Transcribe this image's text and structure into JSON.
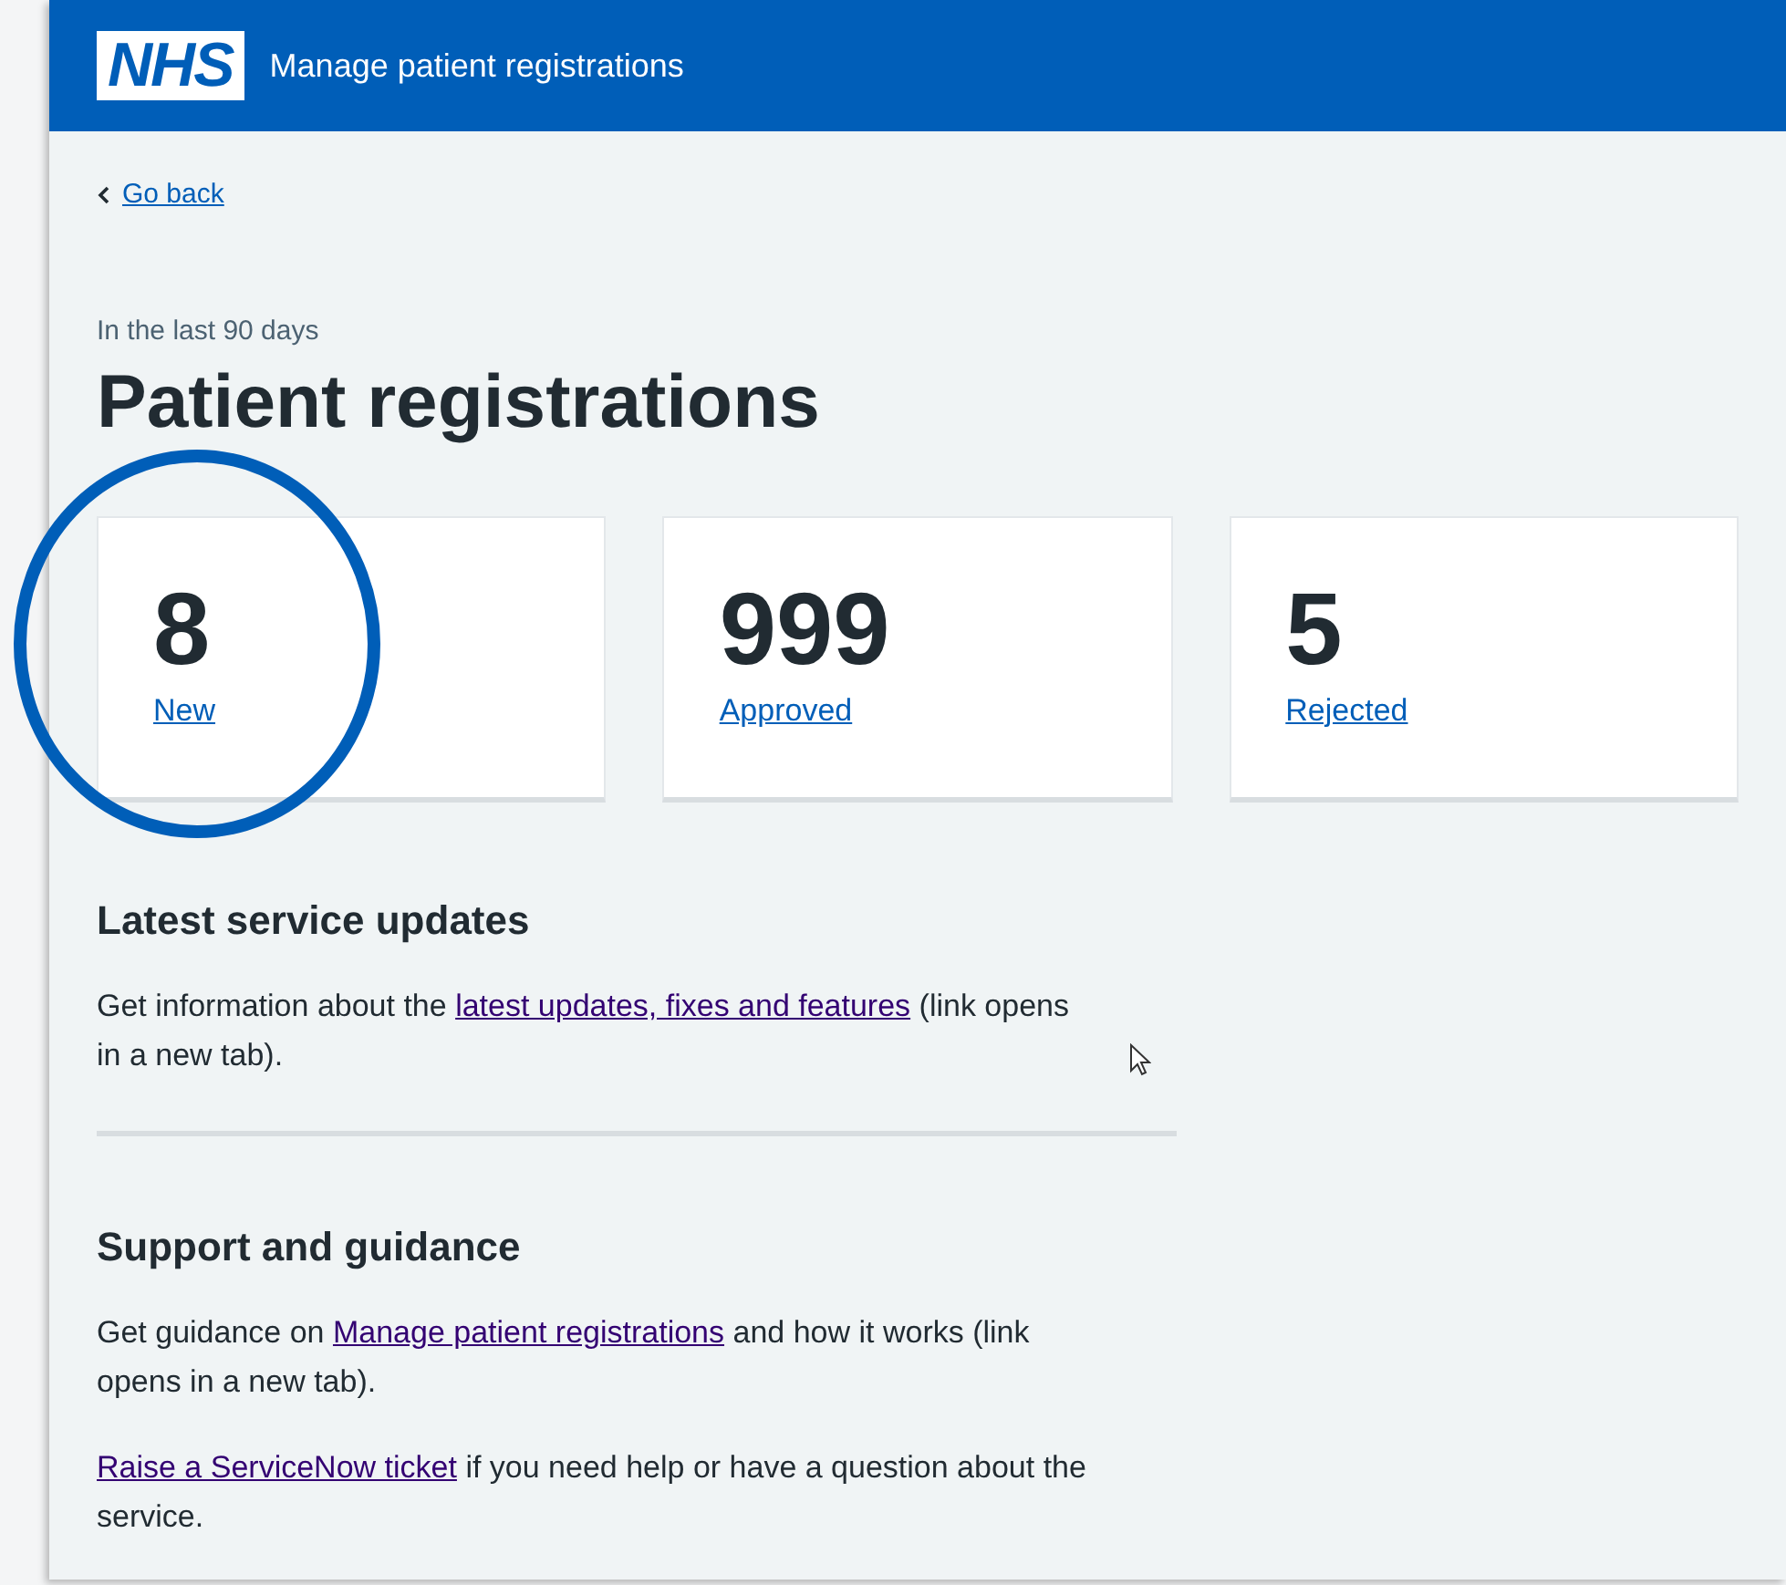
{
  "header": {
    "logo": "NHS",
    "service_name": "Manage patient registrations"
  },
  "back_link": "Go back",
  "caption": "In the last 90 days",
  "title": "Patient registrations",
  "cards": [
    {
      "count": "8",
      "label": "New",
      "highlighted": true
    },
    {
      "count": "999",
      "label": "Approved",
      "highlighted": false
    },
    {
      "count": "5",
      "label": "Rejected",
      "highlighted": false
    }
  ],
  "sections": [
    {
      "heading": "Latest service updates",
      "paragraphs": [
        {
          "before": "Get information about the ",
          "link": "latest updates, fixes and features",
          "after": " (link opens in a new tab)."
        }
      ]
    },
    {
      "heading": "Support and guidance",
      "paragraphs": [
        {
          "before": "Get guidance on ",
          "link": "Manage patient registrations",
          "after": " and how it works (link opens in a new tab)."
        },
        {
          "link": "Raise a ServiceNow ticket",
          "after": " if you need help or have a question about the service."
        }
      ]
    }
  ]
}
